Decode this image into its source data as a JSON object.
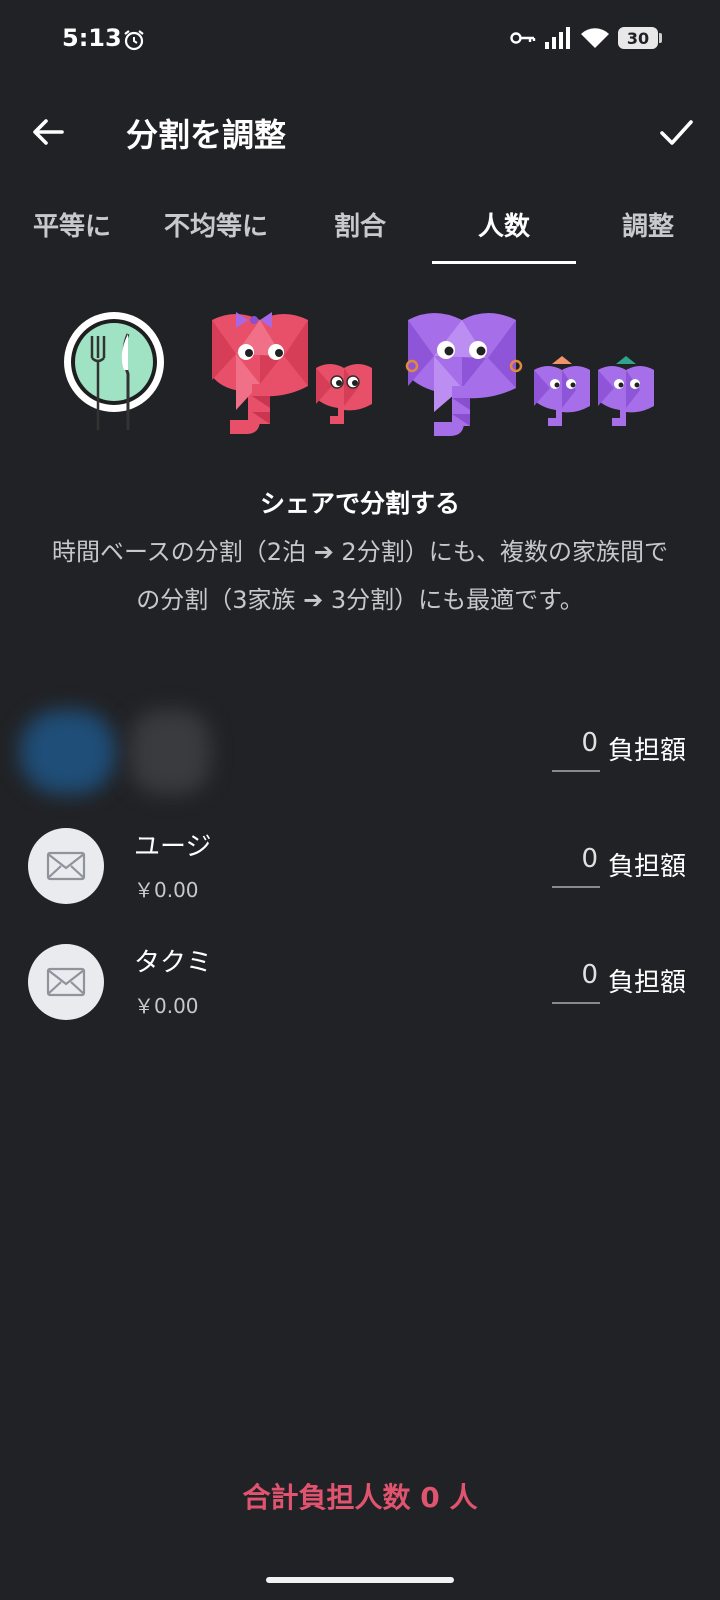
{
  "status": {
    "time": "5:13",
    "battery": "30"
  },
  "header": {
    "title": "分割を調整"
  },
  "tabs": [
    {
      "label": "平等に"
    },
    {
      "label": "不均等に"
    },
    {
      "label": "割合"
    },
    {
      "label": "人数",
      "active": true
    },
    {
      "label": "調整"
    }
  ],
  "info": {
    "heading": "シェアで分割する",
    "description": "時間ベースの分割（2泊 ➔ 2分割）にも、複数の家族間での分割（3家族 ➔ 3分割）にも最適です。"
  },
  "members": [
    {
      "name": "",
      "amount": "",
      "shares": "0",
      "share_label": "負担額"
    },
    {
      "name": "ユージ",
      "amount": "￥0.00",
      "shares": "0",
      "share_label": "負担額"
    },
    {
      "name": "タクミ",
      "amount": "￥0.00",
      "shares": "0",
      "share_label": "負担額"
    }
  ],
  "footer": {
    "total": "合計負担人数 0 人"
  },
  "colors": {
    "background": "#212225",
    "accent": "#e0546f",
    "pink": "#e8506a",
    "purple": "#a66ee8"
  }
}
